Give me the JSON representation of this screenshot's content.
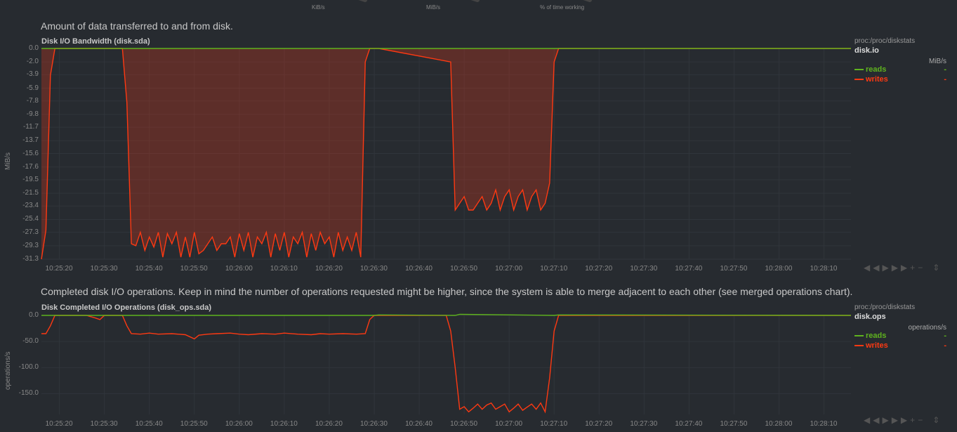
{
  "top_gauges": [
    {
      "unit": "KiB/s"
    },
    {
      "unit": "MiB/s"
    },
    {
      "unit": "% of time working"
    }
  ],
  "chart1": {
    "description": "Amount of data transferred to and from disk.",
    "title": "Disk I/O Bandwidth (disk.sda)",
    "ylabel": "MiB/s",
    "yticks": [
      "0.0",
      "-2.0",
      "-3.9",
      "-5.9",
      "-7.8",
      "-9.8",
      "-11.7",
      "-13.7",
      "-15.6",
      "-17.6",
      "-19.5",
      "-21.5",
      "-23.4",
      "-25.4",
      "-27.3",
      "-29.3",
      "-31.3"
    ],
    "xticks": [
      "10:25:20",
      "10:25:30",
      "10:25:40",
      "10:25:50",
      "10:26:00",
      "10:26:10",
      "10:26:20",
      "10:26:30",
      "10:26:40",
      "10:26:50",
      "10:27:00",
      "10:27:10",
      "10:27:20",
      "10:27:30",
      "10:27:40",
      "10:27:50",
      "10:28:00",
      "10:28:10"
    ],
    "legend": {
      "context": "proc:/proc/diskstats",
      "name": "disk.io",
      "units": "MiB/s",
      "dims": [
        {
          "label": "reads",
          "value": "-",
          "color": "#5fb31e"
        },
        {
          "label": "writes",
          "value": "-",
          "color": "#fe3912"
        }
      ]
    }
  },
  "chart2": {
    "description": "Completed disk I/O operations. Keep in mind the number of operations requested might be higher, since the system is able to merge adjacent to each other (see merged operations chart).",
    "title": "Disk Completed I/O Operations (disk_ops.sda)",
    "ylabel": "operations/s",
    "yticks": [
      "0.0",
      "-50.0",
      "-100.0",
      "-150.0"
    ],
    "xticks": [
      "10:25:20",
      "10:25:30",
      "10:25:40",
      "10:25:50",
      "10:26:00",
      "10:26:10",
      "10:26:20",
      "10:26:30",
      "10:26:40",
      "10:26:50",
      "10:27:00",
      "10:27:10",
      "10:27:20",
      "10:27:30",
      "10:27:40",
      "10:27:50",
      "10:28:00",
      "10:28:10"
    ],
    "legend": {
      "context": "proc:/proc/diskstats",
      "name": "disk.ops",
      "units": "operations/s",
      "dims": [
        {
          "label": "reads",
          "value": "-",
          "color": "#5fb31e"
        },
        {
          "label": "writes",
          "value": "-",
          "color": "#fe3912"
        }
      ]
    }
  },
  "chart_data": [
    {
      "type": "area",
      "title": "Disk I/O Bandwidth (disk.sda)",
      "ylabel": "MiB/s",
      "ylim": [
        -31.3,
        0
      ],
      "x_range": [
        "10:25:16",
        "10:28:16"
      ],
      "series": [
        {
          "name": "reads",
          "color": "#5fb31e",
          "x": [
            "10:25:16",
            "10:28:16"
          ],
          "values": [
            0,
            0
          ]
        },
        {
          "name": "writes",
          "color": "#fe3912",
          "x": [
            "10:25:16",
            "10:25:17",
            "10:25:18",
            "10:25:19",
            "10:25:20",
            "10:25:34",
            "10:25:35",
            "10:25:36",
            "10:25:37",
            "10:25:38",
            "10:25:39",
            "10:25:40",
            "10:25:41",
            "10:25:42",
            "10:25:43",
            "10:25:44",
            "10:25:45",
            "10:25:46",
            "10:25:47",
            "10:25:48",
            "10:25:49",
            "10:25:50",
            "10:25:51",
            "10:25:52",
            "10:25:53",
            "10:25:54",
            "10:25:55",
            "10:25:56",
            "10:25:57",
            "10:25:58",
            "10:25:59",
            "10:26:00",
            "10:26:01",
            "10:26:02",
            "10:26:03",
            "10:26:04",
            "10:26:05",
            "10:26:06",
            "10:26:07",
            "10:26:08",
            "10:26:09",
            "10:26:10",
            "10:26:11",
            "10:26:12",
            "10:26:13",
            "10:26:14",
            "10:26:15",
            "10:26:16",
            "10:26:17",
            "10:26:18",
            "10:26:19",
            "10:26:20",
            "10:26:21",
            "10:26:22",
            "10:26:23",
            "10:26:24",
            "10:26:25",
            "10:26:26",
            "10:26:27",
            "10:26:28",
            "10:26:29",
            "10:26:31",
            "10:26:47",
            "10:26:48",
            "10:26:49",
            "10:26:50",
            "10:26:51",
            "10:26:52",
            "10:26:53",
            "10:26:54",
            "10:26:55",
            "10:26:56",
            "10:26:57",
            "10:26:58",
            "10:26:59",
            "10:27:00",
            "10:27:01",
            "10:27:02",
            "10:27:03",
            "10:27:04",
            "10:27:05",
            "10:27:06",
            "10:27:07",
            "10:27:08",
            "10:27:09",
            "10:27:10",
            "10:27:11",
            "10:28:16"
          ],
          "values": [
            -31.3,
            -27,
            -4,
            0,
            0,
            0,
            -8,
            -29,
            -29.3,
            -27.3,
            -30,
            -28,
            -29.5,
            -27.3,
            -31,
            -27.5,
            -29,
            -27.3,
            -31,
            -28,
            -31,
            -27.3,
            -30.5,
            -30,
            -29,
            -28,
            -30,
            -29,
            -29,
            -28,
            -31,
            -27.5,
            -30,
            -27.3,
            -31,
            -28,
            -29,
            -27.3,
            -31,
            -27.5,
            -30,
            -27.3,
            -31,
            -28,
            -29,
            -27.3,
            -31,
            -27.5,
            -30,
            -27.3,
            -29,
            -28,
            -31,
            -27.3,
            -30,
            -28,
            -30,
            -27.3,
            -31,
            -2,
            0,
            0,
            -2,
            -24,
            -23,
            -22,
            -24,
            -24,
            -23,
            -22,
            -24,
            -23,
            -21,
            -24,
            -22,
            -21,
            -24,
            -22,
            -21,
            -24,
            -22,
            -21,
            -24,
            -23,
            -20,
            -2,
            0,
            0
          ]
        }
      ]
    },
    {
      "type": "line",
      "title": "Disk Completed I/O Operations (disk_ops.sda)",
      "ylabel": "operations/s",
      "ylim": [
        -190,
        0
      ],
      "x_range": [
        "10:25:16",
        "10:28:16"
      ],
      "series": [
        {
          "name": "reads",
          "color": "#5fb31e",
          "x": [
            "10:25:16",
            "10:26:30",
            "10:26:31",
            "10:26:48",
            "10:26:49",
            "10:27:10",
            "10:27:11",
            "10:28:16"
          ],
          "values": [
            0,
            0,
            1,
            0,
            2,
            0,
            1,
            0
          ]
        },
        {
          "name": "writes",
          "color": "#fe3912",
          "x": [
            "10:25:16",
            "10:25:17",
            "10:25:18",
            "10:25:19",
            "10:25:20",
            "10:25:26",
            "10:25:28",
            "10:25:29",
            "10:25:30",
            "10:25:34",
            "10:25:35",
            "10:25:36",
            "10:25:38",
            "10:25:40",
            "10:25:42",
            "10:25:45",
            "10:25:48",
            "10:25:50",
            "10:25:51",
            "10:25:53",
            "10:25:55",
            "10:25:58",
            "10:26:00",
            "10:26:02",
            "10:26:05",
            "10:26:08",
            "10:26:10",
            "10:26:13",
            "10:26:16",
            "10:26:18",
            "10:26:20",
            "10:26:23",
            "10:26:26",
            "10:26:28",
            "10:26:29",
            "10:26:30",
            "10:26:31",
            "10:26:46",
            "10:26:47",
            "10:26:48",
            "10:26:49",
            "10:26:50",
            "10:26:51",
            "10:26:52",
            "10:26:53",
            "10:26:54",
            "10:26:55",
            "10:26:56",
            "10:26:57",
            "10:26:58",
            "10:26:59",
            "10:27:00",
            "10:27:01",
            "10:27:02",
            "10:27:03",
            "10:27:04",
            "10:27:05",
            "10:27:06",
            "10:27:07",
            "10:27:08",
            "10:27:09",
            "10:27:10",
            "10:27:11",
            "10:28:16"
          ],
          "values": [
            -35,
            -35,
            -20,
            0,
            0,
            0,
            -5,
            -8,
            0,
            0,
            -20,
            -35,
            -36,
            -34,
            -36,
            -35,
            -37,
            -45,
            -38,
            -36,
            -35,
            -34,
            -36,
            -37,
            -35,
            -36,
            -34,
            -36,
            -37,
            -35,
            -36,
            -35,
            -36,
            -35,
            -8,
            0,
            0,
            0,
            -30,
            -100,
            -180,
            -175,
            -185,
            -178,
            -170,
            -180,
            -172,
            -168,
            -180,
            -175,
            -170,
            -185,
            -178,
            -170,
            -182,
            -176,
            -170,
            -180,
            -168,
            -185,
            -120,
            -30,
            0,
            0
          ]
        }
      ]
    }
  ]
}
